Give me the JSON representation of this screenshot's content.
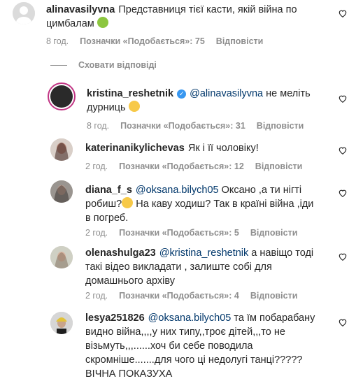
{
  "comments": [
    {
      "username": "alinavasilyvna",
      "mention": "",
      "text": "Представниця тієї касти, якій війна по цимбалам",
      "emoji": "sick-face",
      "time": "8 год.",
      "likes": "Позначки «Подобається»: 75",
      "reply": "Відповісти"
    },
    {
      "username": "kristina_reshetnik",
      "verified": true,
      "mention": "@alinavasilyvna",
      "text": "не меліть дурниць",
      "emoji": "grimace-face",
      "time": "8 год.",
      "likes": "Позначки «Подобається»: 31",
      "reply": "Відповісти"
    },
    {
      "username": "katerinanikylichevas",
      "mention": "",
      "text": "Як і її чоловіку!",
      "time": "2 год.",
      "likes": "Позначки «Подобається»: 12",
      "reply": "Відповісти"
    },
    {
      "username": "diana_f_s",
      "mention": "@oksana.bilych05",
      "text_line1": "Оксано ,а ти нігті",
      "text_line2a": "робиш?",
      "emoji": "thinking-face",
      "text_line2b": " На каву ходиш? Так в країні війна ,іди",
      "text_line3": "в погреб.",
      "time": "2 год.",
      "likes": "Позначки «Подобається»: 5",
      "reply": "Відповісти"
    },
    {
      "username": "olenashulga23",
      "mention": "@kristina_reshetnik",
      "text_line1": "а навіщо тоді",
      "text_line2": "такі відео викладати , залиште собі для",
      "text_line3": "домашнього архіву",
      "time": "2 год.",
      "likes": "Позначки «Подобається»: 4",
      "reply": "Відповісти"
    },
    {
      "username": "lesya251826",
      "mention": "@oksana.bilych05",
      "text_line1": "та їм побарабану",
      "text_line2": "видно війна,,,,у них типу,,троє дітей,,,то не",
      "text_line3": "візьмуть,,,......хоч би себе поводила",
      "text_line4": "скромніше.......для чого ці недолугі танці?????",
      "text_line5": "ВІЧНА ПОКАЗУХА"
    }
  ],
  "hide_replies": "Сховати відповіді",
  "colors": {
    "text": "#262626",
    "meta": "#8e8e8e",
    "mention": "#00376b",
    "verified": "#3897f0"
  }
}
